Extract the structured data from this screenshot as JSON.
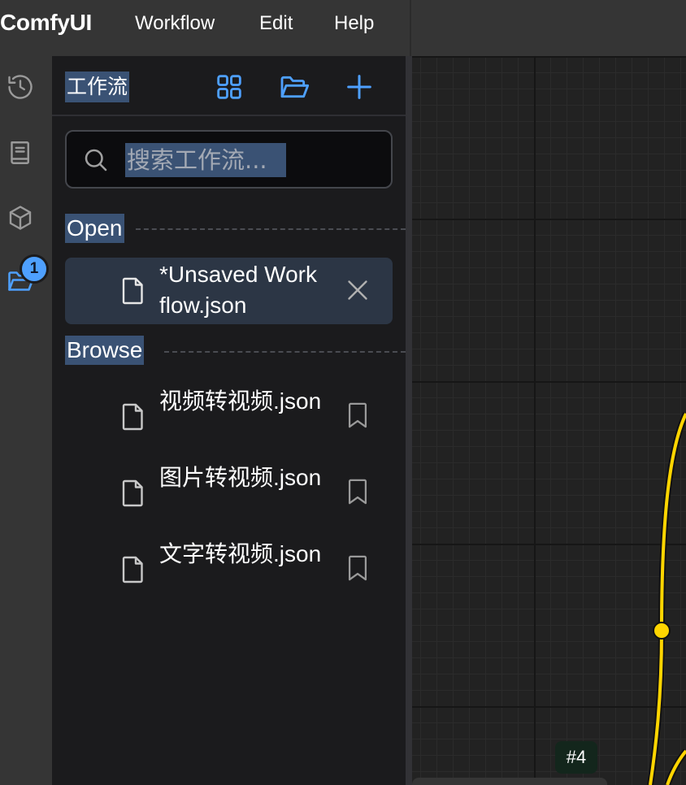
{
  "menubar": {
    "brand": "ComfyUI",
    "items": [
      "Workflow",
      "Edit",
      "Help"
    ]
  },
  "rail": {
    "icons": [
      "history-icon",
      "book-icon",
      "cube-icon",
      "folder-open-icon"
    ],
    "active_index": 3,
    "badge_count": "1",
    "accent_color": "#4ea0ff"
  },
  "panel": {
    "title": "工作流",
    "header_buttons": [
      "grid-icon",
      "folder-open-icon",
      "plus-icon"
    ],
    "search_placeholder": "搜索工作流...",
    "open_section": "Open",
    "open_items": [
      {
        "name": "*Unsaved Workflow.json"
      }
    ],
    "browse_section": "Browse",
    "browse_items": [
      {
        "name": "视频转视频.json"
      },
      {
        "name": "图片转视频.json"
      },
      {
        "name": "文字转视频.json"
      }
    ]
  },
  "canvas": {
    "node_badge": "#4",
    "link_color": "#ffd500"
  }
}
